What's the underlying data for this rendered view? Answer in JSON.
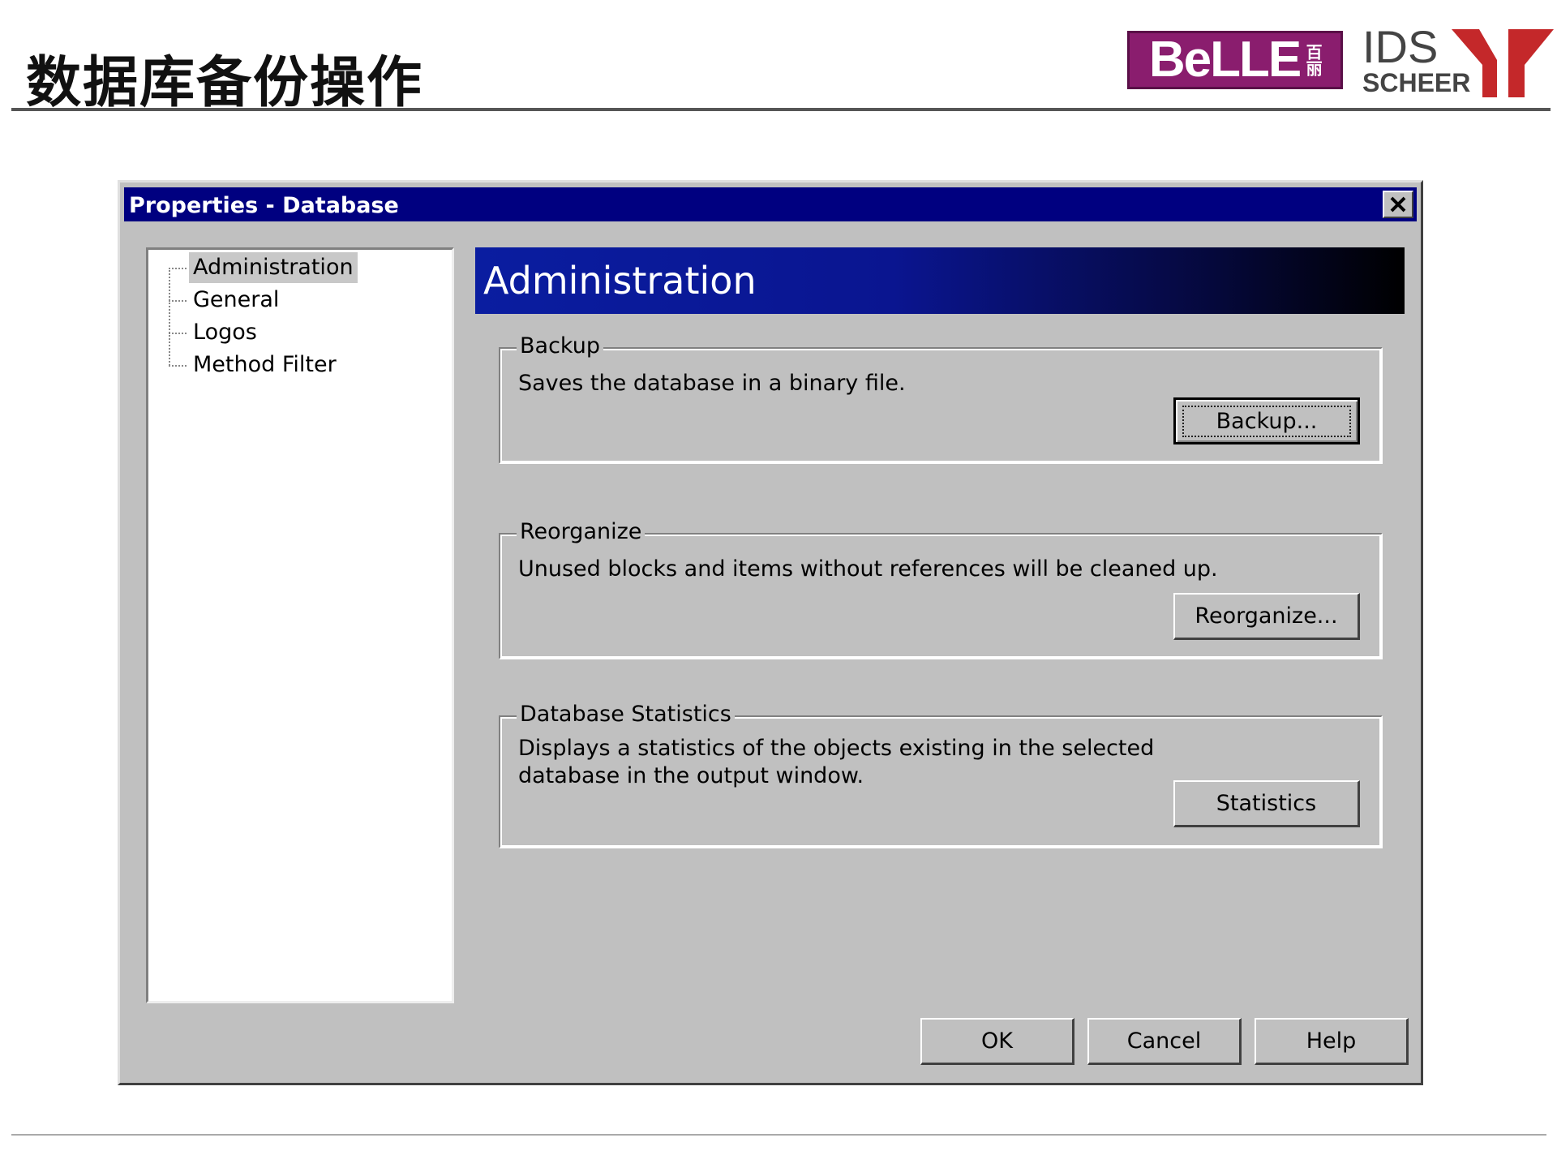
{
  "slide": {
    "title": "数据库备份操作",
    "logo_belle": "BeLLE",
    "logo_belle_cn": "百丽",
    "logo_ids": "IDS",
    "logo_scheer": "SCHEER"
  },
  "window": {
    "title": "Properties - Database",
    "close_icon": "close-icon"
  },
  "tree": {
    "items": [
      {
        "label": "Administration",
        "selected": true
      },
      {
        "label": "General"
      },
      {
        "label": "Logos"
      },
      {
        "label": "Method Filter"
      }
    ]
  },
  "panel": {
    "header": "Administration",
    "groups": {
      "backup": {
        "title": "Backup",
        "description": "Saves the database in a binary file.",
        "button": "Backup..."
      },
      "reorganize": {
        "title": "Reorganize",
        "description": "Unused blocks and items without references will be cleaned up.",
        "button": "Reorganize..."
      },
      "statistics": {
        "title": "Database Statistics",
        "description": "Displays a statistics of the objects existing in the selected\ndatabase in the output window.",
        "button": "Statistics"
      }
    }
  },
  "footer_buttons": {
    "ok": "OK",
    "cancel": "Cancel",
    "help": "Help"
  },
  "colors": {
    "titlebar": "#000080",
    "dialog_face": "#c0c0c0",
    "belle_brand": "#8a1d6e",
    "ids_y": "#c4282a"
  }
}
